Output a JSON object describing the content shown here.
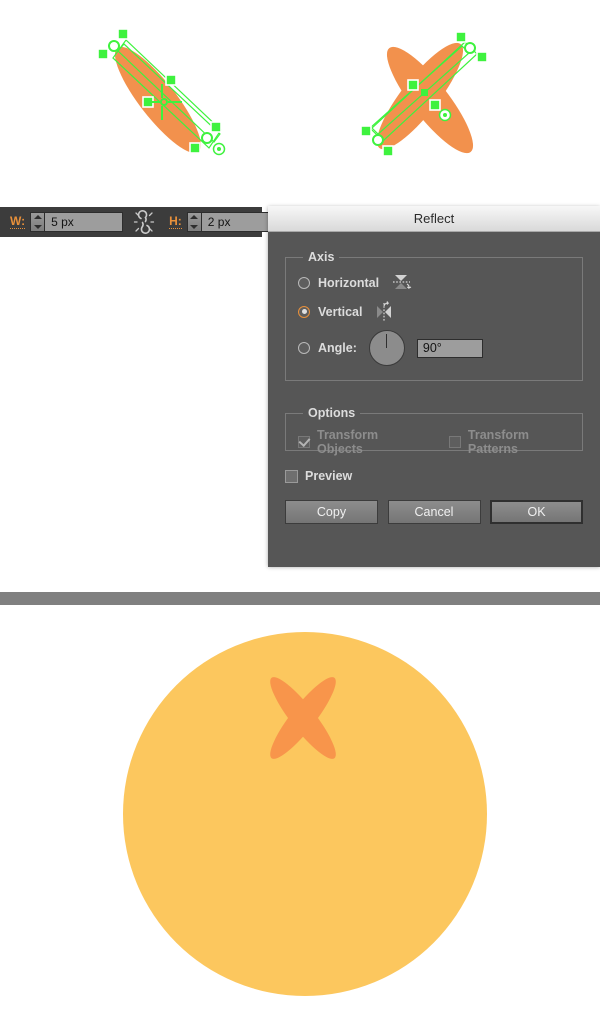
{
  "colors": {
    "ellipse_orange": "#F2914D",
    "circle_yellow": "#FCC75E",
    "result_x_orange": "#F8954B",
    "selection_green": "#3EF23E",
    "toolbar_bg": "#3C3C3C",
    "dialog_bg": "#565656",
    "accent_orange": "#E8903A",
    "divider_gray": "#808080"
  },
  "canvas": {
    "left_artwork": {
      "name": "single-rotated-ellipse-selected",
      "shape": "ellipse",
      "fill": "#F2914D",
      "selection": "bounding-box-with-anchor-points"
    },
    "right_artwork": {
      "name": "reflected-ellipse-pair-x-shape",
      "shape": "two-crossed-ellipses",
      "fill": "#F2914D",
      "selection": "bounding-box-with-anchor-points"
    }
  },
  "toolbar": {
    "width": {
      "label": "W:",
      "value": "5 px",
      "icon": "stepper-icon"
    },
    "link_icon": "broken-link-icon",
    "height": {
      "label": "H:",
      "value": "2 px",
      "icon": "stepper-icon"
    }
  },
  "dialog": {
    "title": "Reflect",
    "axis": {
      "legend": "Axis",
      "options": [
        {
          "label": "Horizontal",
          "selected": false,
          "icon": "reflect-horizontal-icon"
        },
        {
          "label": "Vertical",
          "selected": true,
          "icon": "reflect-vertical-icon"
        }
      ],
      "angle": {
        "label": "Angle:",
        "selected": false,
        "dial_icon": "angle-dial-icon",
        "value": "90°"
      }
    },
    "options": {
      "legend": "Options",
      "checkboxes": [
        {
          "label": "Transform Objects",
          "checked": true,
          "disabled": true
        },
        {
          "label": "Transform Patterns",
          "checked": false,
          "disabled": true
        }
      ]
    },
    "preview": {
      "label": "Preview",
      "checked": false
    },
    "buttons": [
      {
        "label": "Copy",
        "default": false
      },
      {
        "label": "Cancel",
        "default": false
      },
      {
        "label": "OK",
        "default": true
      }
    ]
  },
  "result": {
    "circle": {
      "name": "orange-face-circle",
      "fill": "#FCC75E"
    },
    "mark": {
      "name": "x-cross-mark",
      "fill": "#F8954B"
    }
  }
}
